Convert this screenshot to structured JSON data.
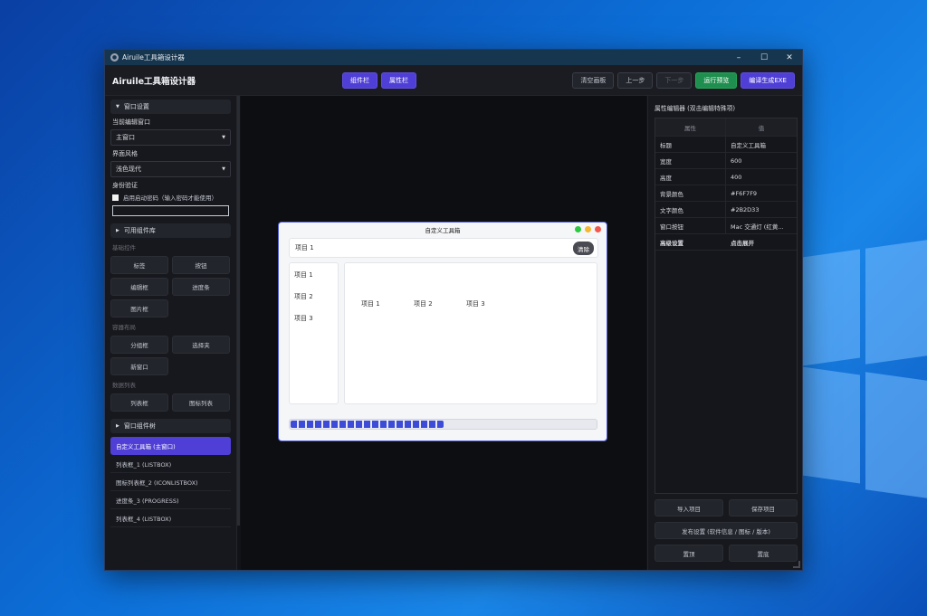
{
  "window": {
    "title": "Airuile工具箱设计器",
    "minimize": "–",
    "maximize": "☐",
    "close": "✕"
  },
  "toolbar": {
    "brand": "Airuile工具箱设计器",
    "tabs": [
      "组件栏",
      "属性栏"
    ],
    "clear_canvas": "清空画板",
    "undo": "上一步",
    "redo": "下一步",
    "run_preview": "运行预览",
    "compile_exe": "编译生成EXE"
  },
  "left": {
    "window_settings": {
      "header": "窗口设置",
      "current_window_label": "当前编辑窗口",
      "current_window_value": "主窗口",
      "style_label": "界面风格",
      "style_value": "浅色现代",
      "auth_label": "身份验证",
      "auth_checkbox": "启用启动密码（输入密码才能使用）"
    },
    "library": {
      "header": "可用组件库",
      "basic_label": "基础控件",
      "basic": [
        "标签",
        "按钮",
        "编辑框",
        "进度条",
        "图片框"
      ],
      "container_label": "容器布局",
      "container": [
        "分组框",
        "选择夹",
        "新窗口"
      ],
      "data_label": "数据列表",
      "data": [
        "列表框",
        "图标列表"
      ]
    },
    "tree": {
      "header": "窗口组件树",
      "items": [
        "自定义工具箱 (主窗口)",
        "列表框_1 (LISTBOX)",
        "图标列表框_2 (ICONLISTBOX)",
        "进度条_3 (PROGRESS)",
        "列表框_4 (LISTBOX)"
      ]
    }
  },
  "preview": {
    "title": "自定义工具箱",
    "bar_text": "项目 1",
    "clear": "清除",
    "list": [
      "项目 1",
      "项目 2",
      "项目 3"
    ],
    "icons": [
      "项目 1",
      "项目 2",
      "项目 3"
    ],
    "progress": 0.5,
    "colors": {
      "green": "#2bc840",
      "yellow": "#f5b730",
      "red": "#f2574f"
    }
  },
  "right": {
    "header": "属性编辑器 (双击编辑特殊项)",
    "col_prop": "属性",
    "col_val": "值",
    "rows": [
      {
        "k": "标题",
        "v": "自定义工具箱"
      },
      {
        "k": "宽度",
        "v": "600"
      },
      {
        "k": "高度",
        "v": "400"
      },
      {
        "k": "背景颜色",
        "v": "#F6F7F9"
      },
      {
        "k": "文字颜色",
        "v": "#2B2D33"
      },
      {
        "k": "窗口按钮",
        "v": "Mac 交通灯 (红黄..."
      },
      {
        "k": "高级设置",
        "v": "点击展开"
      }
    ],
    "import": "导入项目",
    "save": "保存项目",
    "publish": "发布设置 (软件信息 / 图标 / 版本)",
    "top": "置顶",
    "bottom": "置底"
  }
}
